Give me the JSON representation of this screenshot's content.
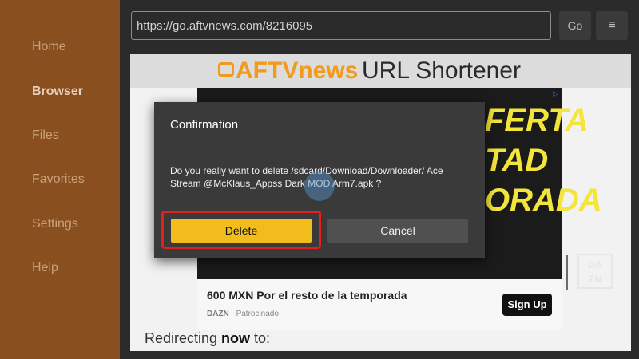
{
  "sidebar": {
    "items": [
      {
        "label": "Home"
      },
      {
        "label": "Browser"
      },
      {
        "label": "Files"
      },
      {
        "label": "Favorites"
      },
      {
        "label": "Settings"
      },
      {
        "label": "Help"
      }
    ],
    "active": "Browser"
  },
  "toolbar": {
    "url": "https://go.aftvnews.com/8216095",
    "go_label": "Go",
    "menu_icon": "≡"
  },
  "webpage": {
    "logo_text": "AFTVnews",
    "title": "URL Shortener",
    "ad": {
      "headline": "FERTA\nTAD\nORADA",
      "brand_badge": "DA\nZN",
      "text": "600 MXN Por el resto de la temporada",
      "brand": "DAZN",
      "sponsored": "Patrocinado",
      "cta": "Sign Up"
    },
    "redirect_prefix": "Redirecting ",
    "redirect_bold": "now",
    "redirect_suffix": " to:"
  },
  "dialog": {
    "title": "Confirmation",
    "message": "Do you really want to delete /sdcard/Download/Downloader/ Ace Stream @McKlaus_Appss Dark MOD Arm7.apk ?",
    "delete_label": "Delete",
    "cancel_label": "Cancel"
  },
  "colors": {
    "sidebar": "#8a4f1e",
    "accent": "#f2bd1c",
    "highlight": "#e81e1e"
  }
}
